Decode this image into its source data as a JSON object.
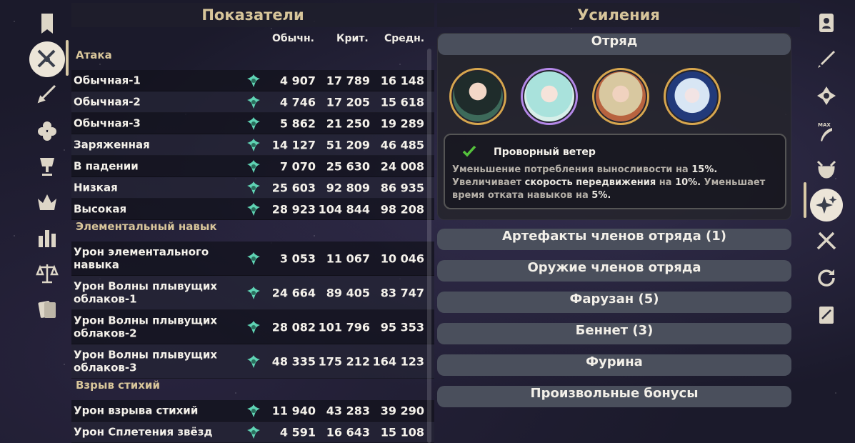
{
  "stats": {
    "title": "Показатели",
    "columns": [
      "Обычн.",
      "Крит.",
      "Средн."
    ],
    "sections": [
      {
        "label": "Атака",
        "rows": [
          {
            "name": "Обычная-1",
            "normal": "4 907",
            "crit": "17 789",
            "avg": "16 148"
          },
          {
            "name": "Обычная-2",
            "normal": "4 746",
            "crit": "17 205",
            "avg": "15 618"
          },
          {
            "name": "Обычная-3",
            "normal": "5 862",
            "crit": "21 250",
            "avg": "19 289"
          },
          {
            "name": "Заряженная",
            "normal": "14 127",
            "crit": "51 209",
            "avg": "46 485"
          },
          {
            "name": "В падении",
            "normal": "7 070",
            "crit": "25 630",
            "avg": "24 008"
          },
          {
            "name": "Низкая",
            "normal": "25 603",
            "crit": "92 809",
            "avg": "86 935"
          },
          {
            "name": "Высокая",
            "normal": "28 923",
            "crit": "104 844",
            "avg": "98 208"
          }
        ]
      },
      {
        "label": "Элементальный навык",
        "rows": [
          {
            "name": "Урон элементального навыка",
            "normal": "3 053",
            "crit": "11 067",
            "avg": "10 046"
          },
          {
            "name": "Урон Волны плывущих облаков-1",
            "normal": "24 664",
            "crit": "89 405",
            "avg": "83 747"
          },
          {
            "name": "Урон Волны плывущих облаков-2",
            "normal": "28 082",
            "crit": "101 796",
            "avg": "95 353"
          },
          {
            "name": "Урон Волны плывущих облаков-3",
            "normal": "48 335",
            "crit": "175 212",
            "avg": "164 123"
          }
        ]
      },
      {
        "label": "Взрыв стихий",
        "rows": [
          {
            "name": "Урон взрыва стихий",
            "normal": "11 940",
            "crit": "43 283",
            "avg": "39 290"
          },
          {
            "name": "Урон Сплетения звёзд",
            "normal": "4 591",
            "crit": "16 643",
            "avg": "15 108"
          }
        ]
      }
    ]
  },
  "buffs": {
    "title": "Усиления",
    "party_header": "Отряд",
    "party": [
      {
        "icon": "character-xianyun-portrait",
        "element": "anemo"
      },
      {
        "icon": "character-faruzan-portrait",
        "element": "anemo"
      },
      {
        "icon": "character-bennett-portrait",
        "element": "pyro"
      },
      {
        "icon": "character-furina-portrait",
        "element": "hydro"
      }
    ],
    "active_buff": {
      "name": "Проворный ветер",
      "desc1_pre": "Уменьшение потребления выносливости на ",
      "desc1_val": "15%.",
      "desc2_pre": "Увеличивает ",
      "desc2_bold": "скорость передвижения",
      "desc2_mid": " на ",
      "desc2_val": "10%.",
      "desc2_post": " Уменьшает время отката навыков на ",
      "desc2_val2": "5%."
    },
    "accordions": [
      "Артефакты членов отряда (1)",
      "Оружие членов отряда",
      "Фарузан (5)",
      "Беннет (3)",
      "Фурина",
      "Произвольные бонусы"
    ]
  },
  "left_rail": [
    "bookmark-icon",
    "crossed-swords-icon",
    "sword-icon",
    "flower-icon",
    "goblet-icon",
    "crown-icon",
    "bar-chart-icon",
    "scales-icon",
    "cards-icon"
  ],
  "right_rail": [
    "character-card-icon",
    "weapon-icon",
    "artifact-icon",
    "max-feather-icon",
    "helmet-icon",
    "sparkle-stars-icon",
    "food-icon",
    "refresh-icon",
    "notebook-icon"
  ],
  "colors": {
    "accent": "#d7c59a",
    "anemo": "#5fd3b4",
    "panel": "#4a4f5c"
  }
}
